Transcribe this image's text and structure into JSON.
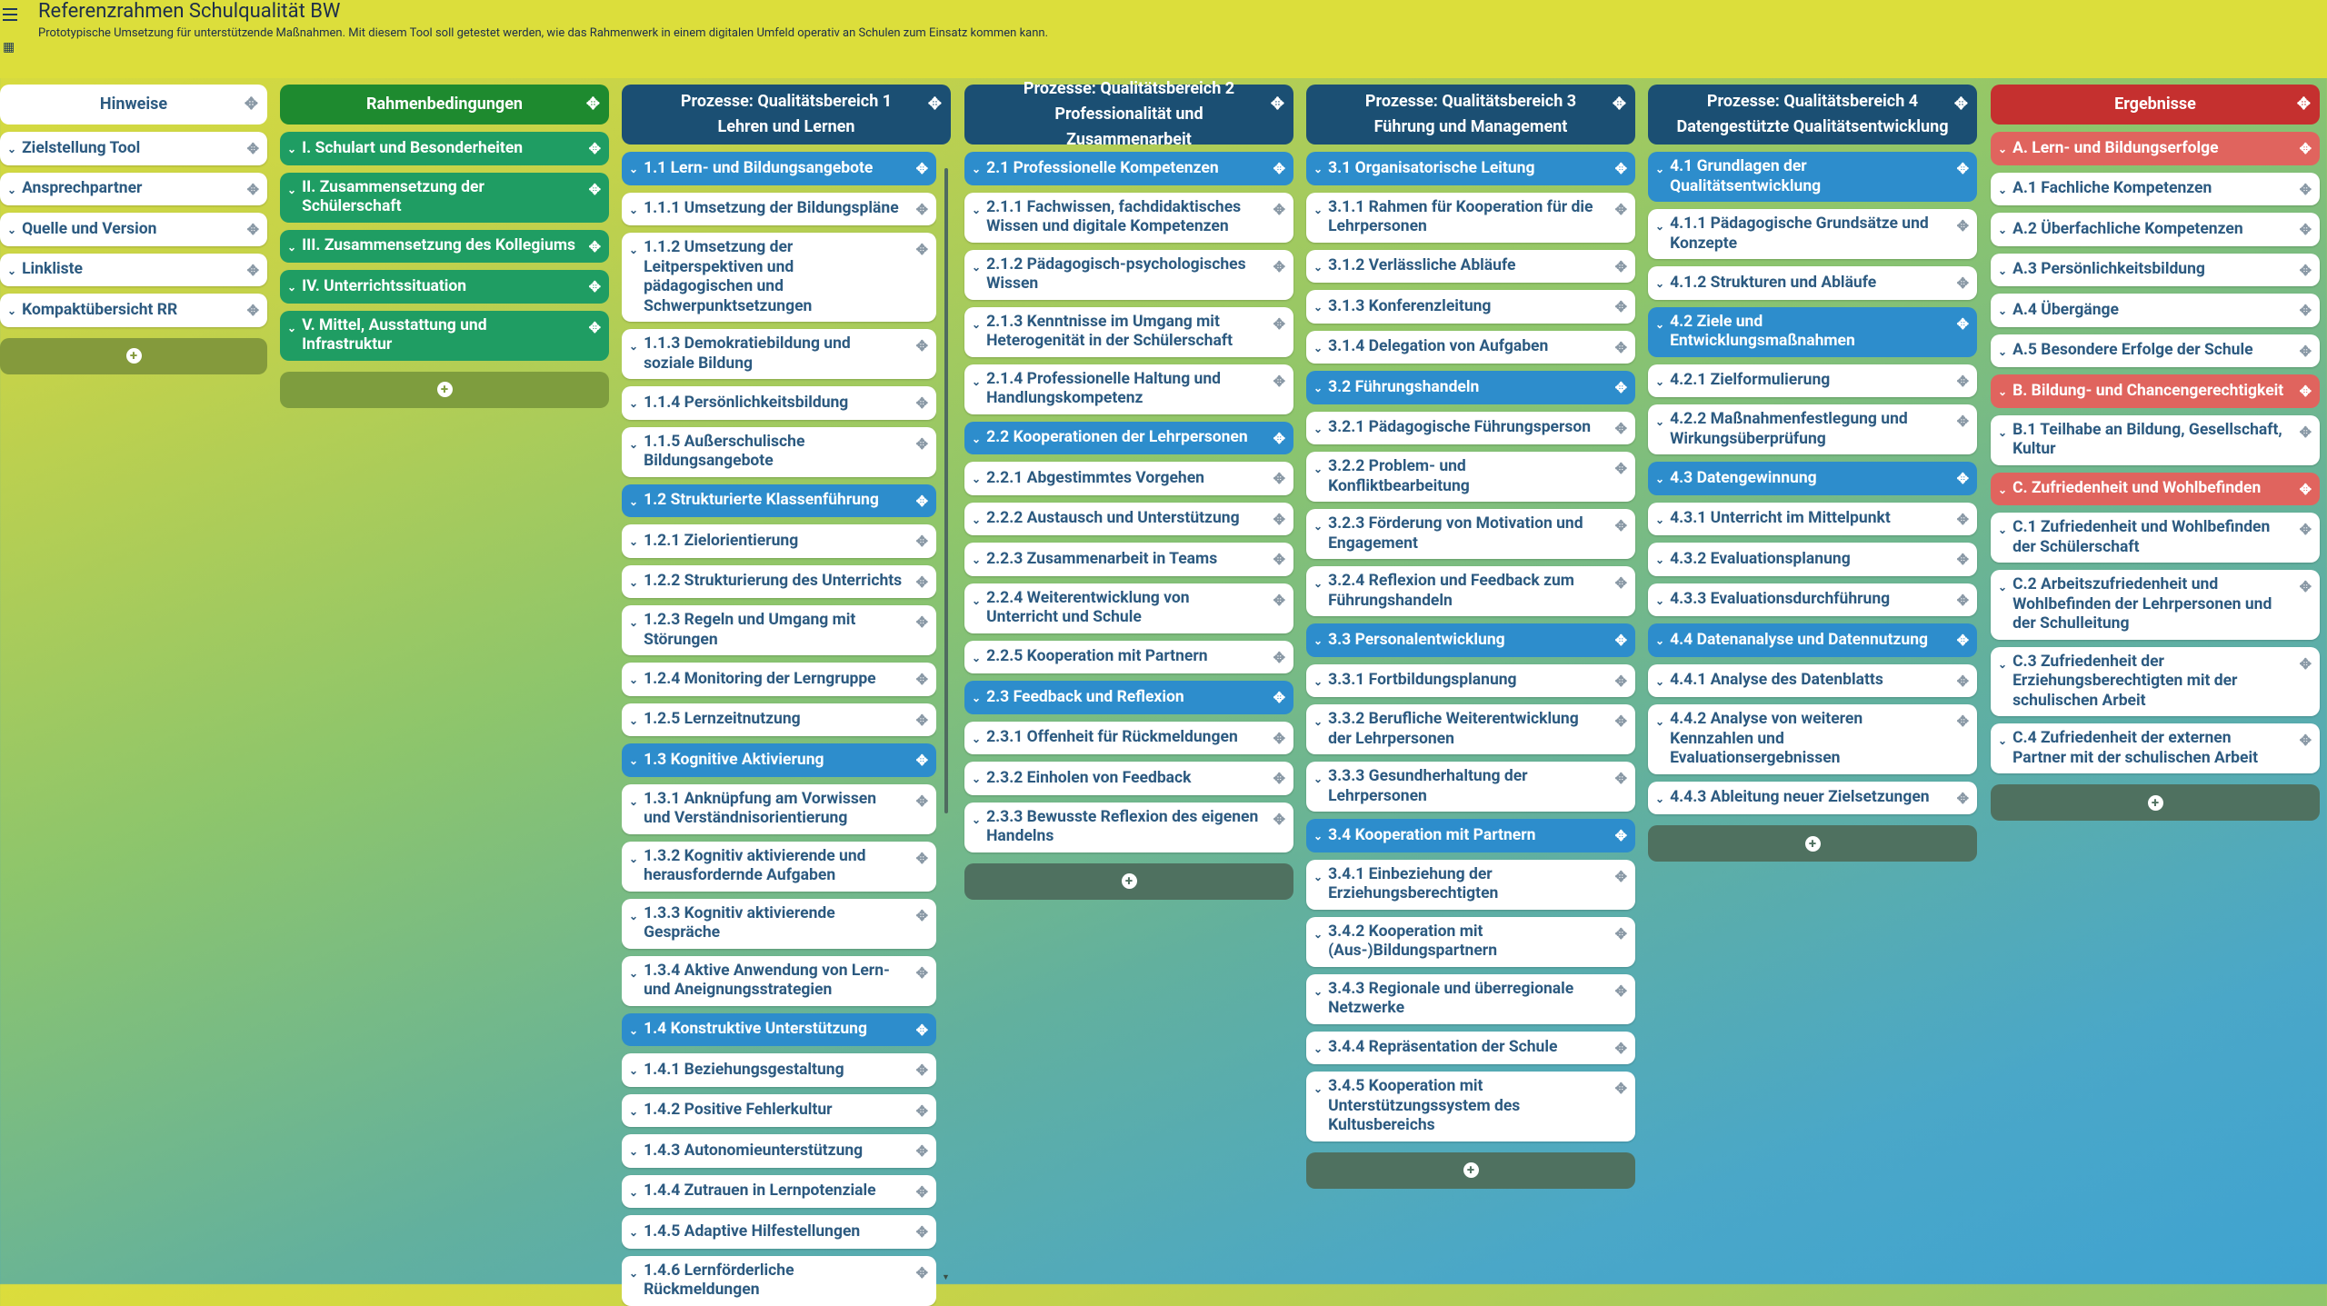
{
  "app": {
    "title": "Referenzrahmen Schulqualität BW",
    "subtitle": "Prototypische Umsetzung für unterstützende Maßnahmen. Mit diesem Tool soll getestet werden, wie das Rahmenwerk in einem digitalen Umfeld operativ an Schulen zum Einsatz kommen kann."
  },
  "icons": {
    "menu": "menu-icon",
    "board": "board-icon",
    "add": "plus-icon",
    "move": "move-icon",
    "chevron": "chevron-down-icon"
  },
  "colors": {
    "header_yellow": "#dcde3b",
    "green_dark": "#1e8a2f",
    "green_card": "#1f9d63",
    "navy": "#1b4f73",
    "blue_card": "#2d8dcc",
    "red_dark": "#c5302f",
    "red_card": "#e0645e"
  },
  "columns": [
    {
      "title_line1": "Hinweise",
      "title_line2": "",
      "cards": [
        "Zielstellung Tool",
        "Ansprechpartner",
        "Quelle und Version",
        "Linkliste",
        "Kompaktübersicht RR"
      ]
    },
    {
      "title_line1": "Rahmenbedingungen",
      "title_line2": "",
      "cards": [
        "I. Schulart und Besonderheiten",
        "II. Zusammensetzung der Schülerschaft",
        "III. Zusammensetzung des Kollegiums",
        "IV. Unterrichtssituation",
        "V. Mittel, Ausstattung und Infrastruktur"
      ]
    },
    {
      "title_line1": "Prozesse: Qualitätsbereich 1",
      "title_line2": "Lehren und Lernen",
      "cards": [
        "1.1 Lern- und Bildungsangebote",
        "1.1.1 Umsetzung der Bildungspläne",
        "1.1.2 Umsetzung der Leitperspektiven und pädagogischen und Schwerpunktsetzungen",
        "1.1.3 Demokratiebildung und soziale Bildung",
        "1.1.4 Persönlichkeitsbildung",
        "1.1.5 Außerschulische Bildungsangebote",
        "1.2 Strukturierte Klassenführung",
        "1.2.1 Zielorientierung",
        "1.2.2 Strukturierung des Unterrichts",
        "1.2.3 Regeln und Umgang mit Störungen",
        "1.2.4 Monitoring der Lerngruppe",
        "1.2.5 Lernzeitnutzung",
        "1.3 Kognitive Aktivierung",
        "1.3.1 Anknüpfung am Vorwissen und Verständnisorientierung",
        "1.3.2 Kognitiv aktivierende und herausfordernde Aufgaben",
        "1.3.3 Kognitiv aktivierende Gespräche",
        "1.3.4 Aktive Anwendung von Lern- und Aneignungsstrategien",
        "1.4 Konstruktive Unterstützung",
        "1.4.1 Beziehungsgestaltung",
        "1.4.2 Positive Fehlerkultur",
        "1.4.3 Autonomieunterstützung",
        "1.4.4 Zutrauen in Lernpotenziale",
        "1.4.5 Adaptive Hilfestellungen",
        "1.4.6 Lernförderliche Rückmeldungen"
      ]
    },
    {
      "title_line1": "Prozesse: Qualitätsbereich 2",
      "title_line2": "Professionalität und Zusammenarbeit",
      "cards": [
        "2.1 Professionelle Kompetenzen",
        "2.1.1 Fachwissen, fachdidaktisches Wissen und digitale Kompetenzen",
        "2.1.2 Pädagogisch-psychologisches Wissen",
        "2.1.3 Kenntnisse im Umgang mit Heterogenität in der Schülerschaft",
        "2.1.4 Professionelle Haltung und Handlungskompetenz",
        "2.2 Kooperationen der Lehrpersonen",
        "2.2.1 Abgestimmtes Vorgehen",
        "2.2.2 Austausch und Unterstützung",
        "2.2.3 Zusammenarbeit in Teams",
        "2.2.4 Weiterentwicklung von Unterricht und Schule",
        "2.2.5 Kooperation mit Partnern",
        "2.3 Feedback und Reflexion",
        "2.3.1 Offenheit für Rückmeldungen",
        "2.3.2 Einholen von Feedback",
        "2.3.3 Bewusste Reflexion des eigenen Handelns"
      ]
    },
    {
      "title_line1": "Prozesse: Qualitätsbereich 3",
      "title_line2": "Führung und Management",
      "cards": [
        "3.1 Organisatorische Leitung",
        "3.1.1 Rahmen für Kooperation für die Lehrpersonen",
        "3.1.2 Verlässliche Abläufe",
        "3.1.3 Konferenzleitung",
        "3.1.4 Delegation von Aufgaben",
        "3.2 Führungshandeln",
        "3.2.1 Pädagogische Führungsperson",
        "3.2.2 Problem- und Konfliktbearbeitung",
        "3.2.3 Förderung von Motivation und Engagement",
        "3.2.4 Reflexion und Feedback zum Führungshandeln",
        "3.3 Personalentwicklung",
        "3.3.1 Fortbildungsplanung",
        "3.3.2 Berufliche Weiterentwicklung der Lehrpersonen",
        "3.3.3 Gesundherhaltung der Lehrpersonen",
        "3.4 Kooperation mit Partnern",
        "3.4.1 Einbeziehung der Erziehungsberechtigten",
        "3.4.2 Kooperation mit (Aus-)Bildungspartnern",
        "3.4.3 Regionale und überregionale Netzwerke",
        "3.4.4 Repräsentation der Schule",
        "3.4.5 Kooperation mit Unterstützungssystem des Kultusbereichs"
      ]
    },
    {
      "title_line1": "Prozesse: Qualitätsbereich 4",
      "title_line2": "Datengestützte Qualitätsentwicklung",
      "cards": [
        "4.1 Grundlagen der Qualitätsentwicklung",
        "4.1.1 Pädagogische Grundsätze und Konzepte",
        "4.1.2 Strukturen und Abläufe",
        "4.2 Ziele und Entwicklungsmaßnahmen",
        "4.2.1 Zielformulierung",
        "4.2.2 Maßnahmenfestlegung und Wirkungsüberprüfung",
        "4.3 Datengewinnung",
        "4.3.1 Unterricht im Mittelpunkt",
        "4.3.2 Evaluationsplanung",
        "4.3.3 Evaluationsdurchführung",
        "4.4 Datenanalyse und Datennutzung",
        "4.4.1 Analyse des Datenblatts",
        "4.4.2 Analyse von weiteren Kennzahlen und Evaluationsergebnissen",
        "4.4.3 Ableitung neuer Zielsetzungen"
      ]
    },
    {
      "title_line1": "Ergebnisse",
      "title_line2": "",
      "cards": [
        "A. Lern- und Bildungserfolge",
        "A.1 Fachliche Kompetenzen",
        "A.2 Überfachliche Kompetenzen",
        "A.3 Persönlichkeitsbildung",
        "A.4 Übergänge",
        "A.5 Besondere Erfolge der Schule",
        "B. Bildung- und Chancengerechtigkeit",
        "B.1 Teilhabe an Bildung, Gesellschaft, Kultur",
        "C. Zufriedenheit und Wohlbefinden",
        "C.1 Zufriedenheit und Wohlbefinden der Schülerschaft",
        "C.2 Arbeitszufriedenheit und Wohlbefinden der Lehrpersonen und der Schulleitung",
        "C.3 Zufriedenheit der Erziehungsberechtigten mit der schulischen Arbeit",
        "C.4 Zufriedenheit der externen Partner mit der schulischen Arbeit"
      ]
    }
  ]
}
